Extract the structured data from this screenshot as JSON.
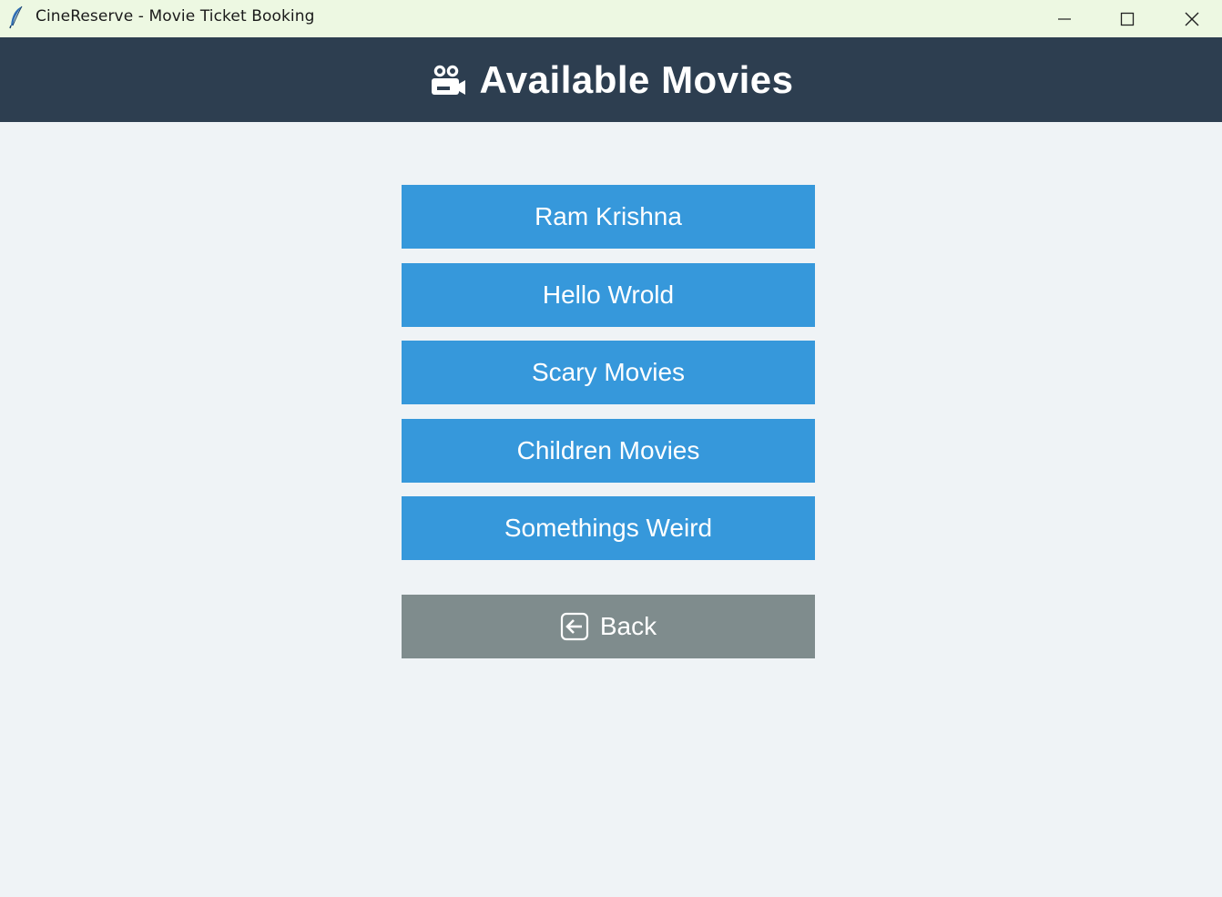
{
  "window": {
    "title": "CineReserve - Movie Ticket Booking",
    "icon": "feather-icon"
  },
  "header": {
    "icon": "movie-camera-icon",
    "title": "Available Movies",
    "background": "#2d3e50"
  },
  "movies": [
    {
      "label": "Ram Krishna"
    },
    {
      "label": "Hello Wrold"
    },
    {
      "label": "Scary Movies"
    },
    {
      "label": "Children Movies"
    },
    {
      "label": "Somethings Weird"
    }
  ],
  "back": {
    "label": "Back",
    "icon": "back-arrow-icon"
  },
  "colors": {
    "movie_button": "#3698db",
    "back_button": "#7f8c8d",
    "background": "#eff3f6"
  }
}
